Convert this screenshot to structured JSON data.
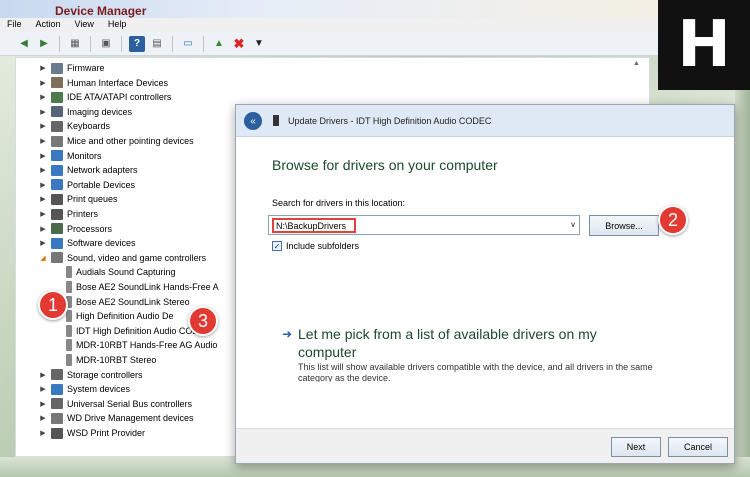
{
  "device_manager": {
    "title": "Device Manager",
    "menu": [
      "File",
      "Action",
      "View",
      "Help"
    ],
    "toolbar_icons": [
      "back-arrow-icon",
      "forward-arrow-icon",
      "properties-icon",
      "show-hidden-icon",
      "help-icon",
      "scan-hardware-icon",
      "update-driver-icon",
      "uninstall-icon",
      "disable-icon"
    ],
    "tree": [
      {
        "label": "Firmware",
        "expanded": false,
        "level": 0,
        "icon_color": "#6b7a8f"
      },
      {
        "label": "Human Interface Devices",
        "expanded": false,
        "level": 0,
        "icon_color": "#7d6f5a"
      },
      {
        "label": "IDE ATA/ATAPI controllers",
        "expanded": false,
        "level": 0,
        "icon_color": "#4b7c4b"
      },
      {
        "label": "Imaging devices",
        "expanded": false,
        "level": 0,
        "icon_color": "#556577"
      },
      {
        "label": "Keyboards",
        "expanded": false,
        "level": 0,
        "icon_color": "#666666"
      },
      {
        "label": "Mice and other pointing devices",
        "expanded": false,
        "level": 0,
        "icon_color": "#777777"
      },
      {
        "label": "Monitors",
        "expanded": false,
        "level": 0,
        "icon_color": "#3a78c2"
      },
      {
        "label": "Network adapters",
        "expanded": false,
        "level": 0,
        "icon_color": "#3a78c2"
      },
      {
        "label": "Portable Devices",
        "expanded": false,
        "level": 0,
        "icon_color": "#3a78c2"
      },
      {
        "label": "Print queues",
        "expanded": false,
        "level": 0,
        "icon_color": "#555555"
      },
      {
        "label": "Printers",
        "expanded": false,
        "level": 0,
        "icon_color": "#555555"
      },
      {
        "label": "Processors",
        "expanded": false,
        "level": 0,
        "icon_color": "#4b6b4b"
      },
      {
        "label": "Software devices",
        "expanded": false,
        "level": 0,
        "icon_color": "#3a78c2"
      },
      {
        "label": "Sound, video and game controllers",
        "expanded": true,
        "level": 0,
        "icon_color": "#777777"
      },
      {
        "label": "Audials Sound Capturing",
        "level": 1,
        "icon_color": "#888888"
      },
      {
        "label": "Bose AE2 SoundLink Hands-Free A",
        "level": 1,
        "icon_color": "#888888"
      },
      {
        "label": "Bose AE2 SoundLink Stereo",
        "level": 1,
        "icon_color": "#888888"
      },
      {
        "label": "High Definition Audio De",
        "level": 1,
        "icon_color": "#888888"
      },
      {
        "label": "IDT High Definition Audio CODEC",
        "level": 1,
        "icon_color": "#888888"
      },
      {
        "label": "MDR-10RBT Hands-Free AG Audio",
        "level": 1,
        "icon_color": "#888888"
      },
      {
        "label": "MDR-10RBT Stereo",
        "level": 1,
        "icon_color": "#888888"
      },
      {
        "label": "Storage controllers",
        "expanded": false,
        "level": 0,
        "icon_color": "#666666"
      },
      {
        "label": "System devices",
        "expanded": false,
        "level": 0,
        "icon_color": "#3a78c2"
      },
      {
        "label": "Universal Serial Bus controllers",
        "expanded": false,
        "level": 0,
        "icon_color": "#666666"
      },
      {
        "label": "WD Drive Management devices",
        "expanded": false,
        "level": 0,
        "icon_color": "#777777"
      },
      {
        "label": "WSD Print Provider",
        "expanded": false,
        "level": 0,
        "icon_color": "#555555"
      }
    ]
  },
  "update_drivers": {
    "title": "Update Drivers - IDT High Definition Audio CODEC",
    "heading": "Browse for drivers on your computer",
    "search_label": "Search for drivers in this location:",
    "path_value": "N:\\BackupDrivers",
    "browse_label": "Browse...",
    "include_subfolders_label": "Include subfolders",
    "include_subfolders_checked": true,
    "pick_link": "Let me pick from a list of available drivers on my computer",
    "pick_desc": "This list will show available drivers compatible with the device, and all drivers in the same category as the device.",
    "next_label": "Next",
    "cancel_label": "Cancel"
  },
  "badges": [
    "1",
    "2",
    "3"
  ],
  "logo_text": "H",
  "colors": {
    "badge": "#e23a32",
    "accent": "#2b5f9e",
    "heading": "#1b4a2b",
    "highlight_border": "#e0413a"
  }
}
